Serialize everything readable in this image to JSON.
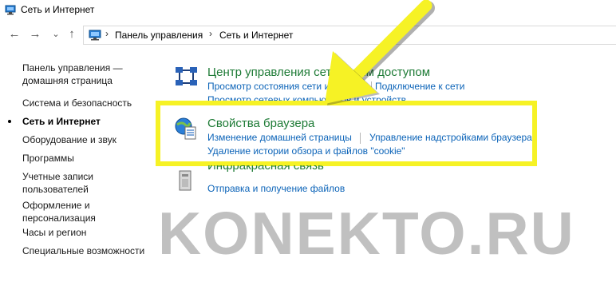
{
  "window": {
    "title": "Сеть и Интернет"
  },
  "breadcrumb": {
    "items": [
      "Панель управления",
      "Сеть и Интернет"
    ]
  },
  "sidebar": {
    "items": [
      {
        "label_lines": [
          "Панель управления —",
          "домашняя страница"
        ]
      },
      {
        "label_lines": [
          "Система и безопасность"
        ]
      },
      {
        "label_lines": [
          "Сеть и Интернет"
        ],
        "active": true
      },
      {
        "label_lines": [
          "Оборудование и звук"
        ]
      },
      {
        "label_lines": [
          "Программы"
        ]
      },
      {
        "label_lines": [
          "Учетные записи",
          "пользователей"
        ]
      },
      {
        "label_lines": [
          "Оформление и",
          "персонализация"
        ]
      },
      {
        "label_lines": [
          "Часы и регион"
        ]
      },
      {
        "label_lines": [
          "Специальные возможности"
        ]
      }
    ]
  },
  "categories": {
    "network_center": {
      "title": "Центр управления сетями и общим доступом",
      "title_visible": "Центр управления сетям      щим доступом",
      "links": [
        "Просмотр состояния сети и за",
        "Подключение к сети",
        "Просмотр сетевых компьютеров и устройств"
      ]
    },
    "browser_props": {
      "title": "Свойства браузера",
      "links": [
        "Изменение домашней страницы",
        "Управление надстройками браузера",
        "Удаление истории обзора и файлов \"cookie\""
      ]
    },
    "infrared": {
      "title": "Инфракрасная связь",
      "links": [
        "Отправка и получение файлов"
      ]
    }
  },
  "watermark": "KONEKTO.RU",
  "colors": {
    "highlight": "#f6f225",
    "category_title": "#1e7b36",
    "link": "#0b63b8"
  },
  "icons": {
    "back": "←",
    "forward": "→",
    "dropdown": "⌄",
    "up": "↑",
    "breadcrumb_sep": "›"
  }
}
